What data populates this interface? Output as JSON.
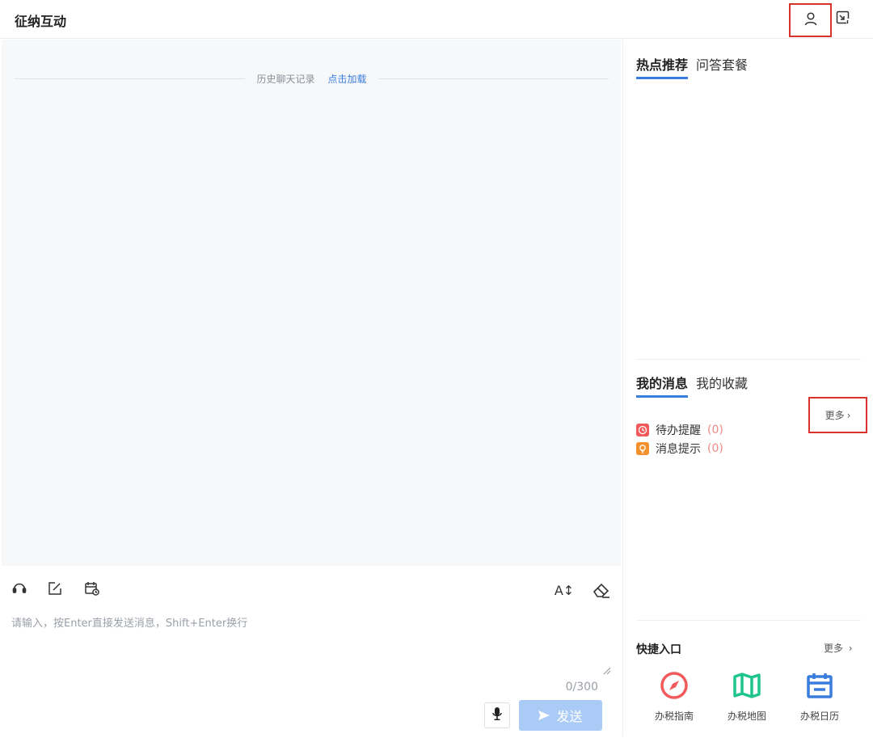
{
  "header": {
    "title": "征纳互动"
  },
  "chat": {
    "history_label": "历史聊天记录",
    "history_load": "点击加载"
  },
  "input": {
    "placeholder": "请输入，按Enter直接发送消息，Shift+Enter换行",
    "value": "",
    "counter": "0/300",
    "font_tool": "A↕",
    "send_label": "发送"
  },
  "hot": {
    "tabs": [
      {
        "label": "热点推荐",
        "active": true
      },
      {
        "label": "问答套餐",
        "active": false
      }
    ]
  },
  "messages": {
    "tabs": [
      {
        "label": "我的消息",
        "active": true
      },
      {
        "label": "我的收藏",
        "active": false
      }
    ],
    "more_label": "更多",
    "items": [
      {
        "label": "待办提醒",
        "count": "(0)",
        "color": "#f05a5a"
      },
      {
        "label": "消息提示",
        "count": "(0)",
        "color": "#f5902f"
      }
    ]
  },
  "quick": {
    "title": "快捷入口",
    "more_label": "更多",
    "items": [
      {
        "label": "办税指南",
        "icon": "compass-icon",
        "color": "#f05a5a"
      },
      {
        "label": "办税地图",
        "icon": "map-icon",
        "color": "#1fc58d"
      },
      {
        "label": "办税日历",
        "icon": "calendar-icon",
        "color": "#3b7ddd"
      }
    ]
  },
  "colors": {
    "accent": "#3b7ddd",
    "highlight_border": "#d9322b",
    "send_disabled": "#a9cbf5"
  }
}
